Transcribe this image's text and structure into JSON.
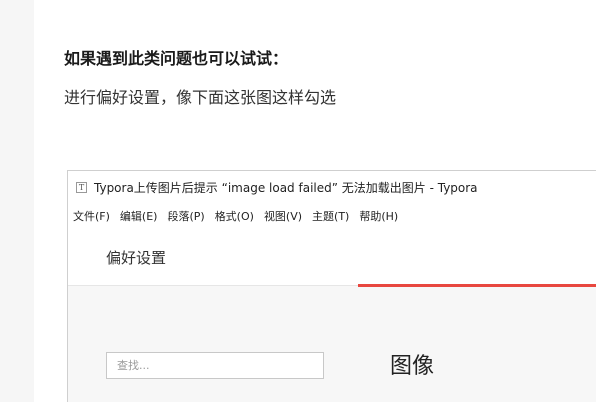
{
  "article": {
    "heading": "如果遇到此类问题也可以试试：",
    "body": "进行偏好设置，像下面这张图这样勾选"
  },
  "screenshot": {
    "window_title": "Typora上传图片后提示 “image load failed” 无法加载出图片 - Typora",
    "app_icon_glyph": "T",
    "menu": [
      {
        "label": "文件(F)"
      },
      {
        "label": "编辑(E)"
      },
      {
        "label": "段落(P)"
      },
      {
        "label": "格式(O)"
      },
      {
        "label": "视图(V)"
      },
      {
        "label": "主题(T)"
      },
      {
        "label": "帮助(H)"
      }
    ],
    "prefs_title": "偏好设置",
    "search": {
      "value": "",
      "placeholder": "查找..."
    },
    "section_title": "图像"
  },
  "colors": {
    "accent": "#e8473f",
    "page_bg": "#f6f6f6"
  }
}
